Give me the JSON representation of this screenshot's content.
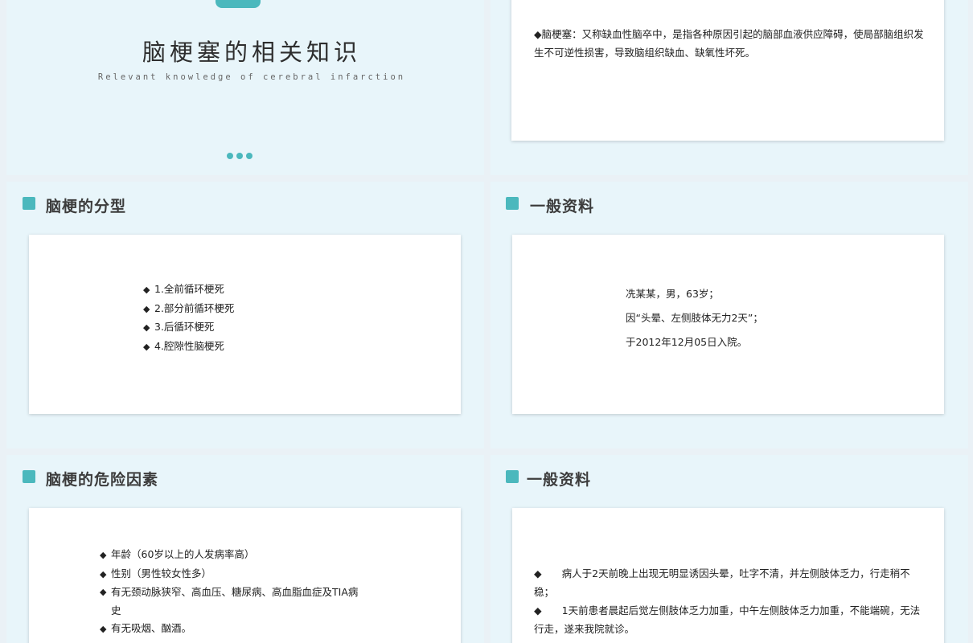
{
  "slide1": {
    "title": "脑梗塞的相关知识",
    "subtitle": "Relevant knowledge of cerebral infarction"
  },
  "slide2": {
    "definition": "◆脑梗塞：又称缺血性脑卒中，是指各种原因引起的脑部血液供应障碍，使局部脑组织发生不可逆性损害，导致脑组织缺血、缺氧性坏死。"
  },
  "slide3": {
    "heading": "脑梗的分型",
    "bullet": "◆",
    "items": [
      "1.全前循环梗死",
      "2.部分前循环梗死",
      "3.后循环梗死",
      "4.腔隙性脑梗死"
    ]
  },
  "slide4": {
    "heading": "一般资料",
    "lines": [
      "冼某某，男，63岁；",
      "因“头晕、左侧肢体无力2天”；",
      "于2012年12月05日入院。"
    ]
  },
  "slide5": {
    "heading": "脑梗的危险因素",
    "bullet": "◆",
    "items": [
      "年龄（60岁以上的人发病率高）",
      "性别（男性较女性多）",
      "有无颈动脉狭窄、高血压、糖尿病、高血脂血症及TIA病史",
      "有无吸烟、酗酒。"
    ]
  },
  "slide6": {
    "heading": "一般资料",
    "para1": "◆　　病人于2天前晚上出现无明显诱因头晕，吐字不清，并左侧肢体乏力，行走稍不稳；",
    "para2": "◆　　1天前患者晨起后觉左侧肢体乏力加重，中午左侧肢体乏力加重，不能端碗，无法行走，遂来我院就诊。"
  }
}
